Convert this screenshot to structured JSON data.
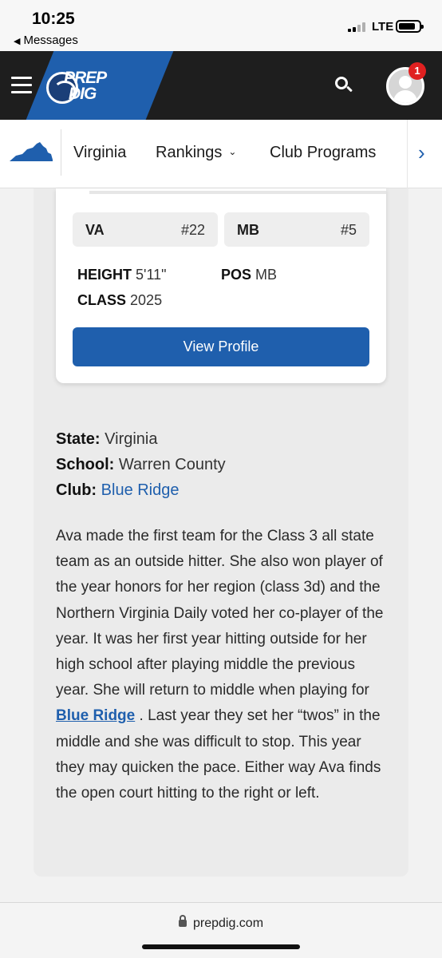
{
  "status_bar": {
    "time": "10:25",
    "back_label": "Messages",
    "network": "LTE"
  },
  "header": {
    "logo_line1": "PREP",
    "logo_line2": "DIG",
    "notification_count": "1"
  },
  "subnav": {
    "items": [
      "Virginia",
      "Rankings",
      "Club Programs"
    ]
  },
  "player": {
    "chips": [
      {
        "label": "VA",
        "value": "#22"
      },
      {
        "label": "MB",
        "value": "#5"
      }
    ],
    "height_label": "HEIGHT",
    "height_value": "5'11\"",
    "pos_label": "POS",
    "pos_value": "MB",
    "class_label": "CLASS",
    "class_value": "2025",
    "button_label": "View Profile"
  },
  "details": {
    "state_label": "State:",
    "state_value": "Virginia",
    "school_label": "School:",
    "school_value": "Warren County",
    "club_label": "Club:",
    "club_value": "Blue Ridge"
  },
  "bio": {
    "before_link": "Ava made the first team for the Class 3 all state team as an outside hitter.  She also won player of the year honors for her region (class 3d) and the Northern Virginia Daily voted her co-player of the year.  It was her first year hitting outside for her high school after playing middle the previous year.  She will return to middle when playing for",
    "link": "Blue Ridge",
    "after_link": ".  Last year they set her “twos” in the middle and she was difficult to stop.  This year they may quicken the pace.  Either way Ava finds the open court hitting to the right or left."
  },
  "browser": {
    "url": "prepdig.com"
  },
  "colors": {
    "brand_blue": "#1f5fad",
    "header_dark": "#1e1e1e",
    "badge_red": "#e02020"
  }
}
